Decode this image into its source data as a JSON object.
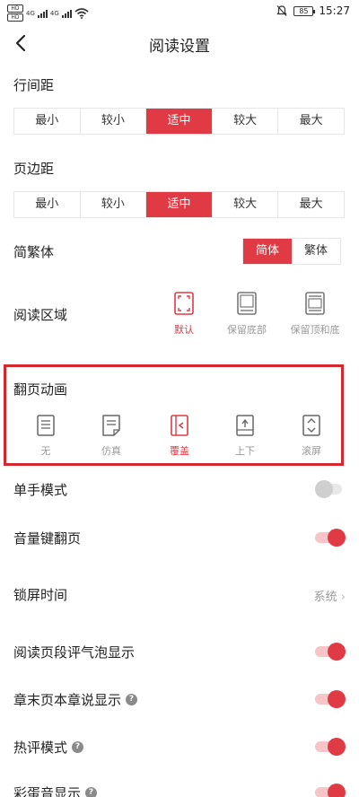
{
  "status_bar": {
    "sim1": "HD",
    "sim2": "HD",
    "net1": "4G",
    "net2": "4G",
    "battery": "85",
    "time": "15:27"
  },
  "header": {
    "title": "阅读设置"
  },
  "line_spacing": {
    "label": "行间距",
    "options": [
      "最小",
      "较小",
      "适中",
      "较大",
      "最大"
    ],
    "selected": "适中"
  },
  "page_margin": {
    "label": "页边距",
    "options": [
      "最小",
      "较小",
      "适中",
      "较大",
      "最大"
    ],
    "selected": "适中"
  },
  "script": {
    "label": "简繁体",
    "options": [
      "简体",
      "繁体"
    ],
    "selected": "简体"
  },
  "reading_area": {
    "label": "阅读区域",
    "options": [
      {
        "label": "默认",
        "icon": "full-screen-icon"
      },
      {
        "label": "保留底部",
        "icon": "keep-bottom-icon"
      },
      {
        "label": "保留顶和底",
        "icon": "keep-top-bottom-icon"
      }
    ],
    "selected": "默认"
  },
  "page_animation": {
    "label": "翻页动画",
    "options": [
      {
        "label": "无",
        "icon": "page-none-icon"
      },
      {
        "label": "仿真",
        "icon": "page-curl-icon"
      },
      {
        "label": "覆盖",
        "icon": "page-cover-icon"
      },
      {
        "label": "上下",
        "icon": "page-updown-icon"
      },
      {
        "label": "滚屏",
        "icon": "page-scroll-icon"
      }
    ],
    "selected": "覆盖"
  },
  "settings": {
    "one_hand": {
      "label": "单手模式",
      "on": false
    },
    "volume_key": {
      "label": "音量键翻页",
      "on": true
    },
    "lock_screen": {
      "label": "锁屏时间",
      "value": "系统"
    },
    "paragraph_bubble": {
      "label": "阅读页段评气泡显示",
      "on": true
    },
    "chapter_end_note": {
      "label": "章末页本章说显示",
      "on": true
    },
    "hot_comment": {
      "label": "热评模式",
      "on": true
    },
    "easter_egg": {
      "label": "彩蛋音显示",
      "on": true
    }
  },
  "colors": {
    "accent": "#e03a44",
    "highlight_border": "#d3282e"
  }
}
